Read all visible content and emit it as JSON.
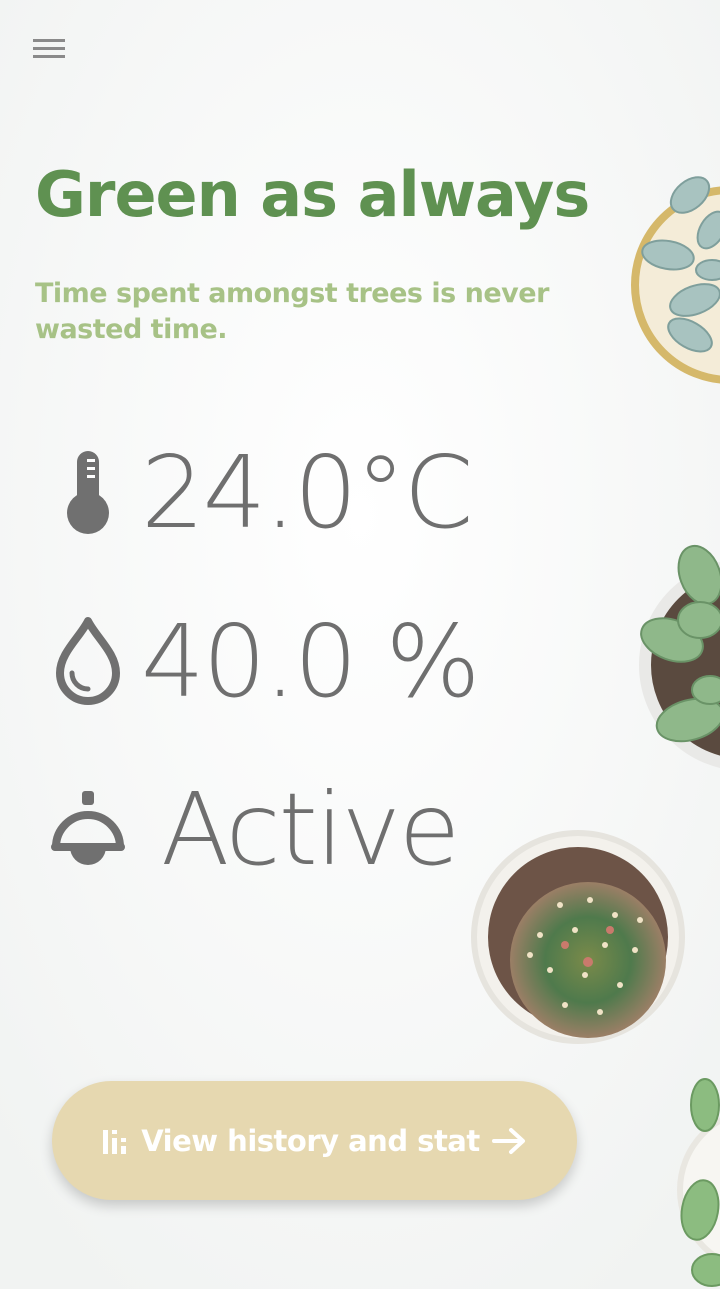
{
  "header": {
    "menu_icon": "hamburger-menu-icon"
  },
  "hero": {
    "title": "Green as always",
    "subtitle": "Time spent amongst trees is never wasted time."
  },
  "stats": {
    "temperature": {
      "icon": "thermometer-icon",
      "value": "24.0°C"
    },
    "humidity": {
      "icon": "water-drop-icon",
      "value": "40.0 %"
    },
    "lamp": {
      "icon": "lamp-icon",
      "value": "Active"
    }
  },
  "actions": {
    "history_button": {
      "label": "View history and stat",
      "icon": "bar-chart-icon",
      "arrow_icon": "arrow-right-icon"
    }
  },
  "colors": {
    "title": "#5f9151",
    "subtitle": "#a7c286",
    "stat_text": "#6f6f6f",
    "button_bg": "#e6d8b0",
    "button_text": "#ffffff"
  }
}
